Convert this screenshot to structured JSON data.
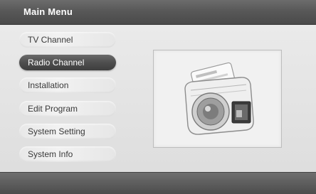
{
  "header": {
    "title": "Main Menu"
  },
  "menu": {
    "items": [
      {
        "label": "TV Channel"
      },
      {
        "label": "Radio Channel"
      },
      {
        "label": "Installation"
      },
      {
        "label": "Edit Program"
      },
      {
        "label": "System Setting"
      },
      {
        "label": "System Info"
      }
    ],
    "selected": "Radio Channel"
  },
  "preview": {
    "icon": "radio-icon"
  }
}
